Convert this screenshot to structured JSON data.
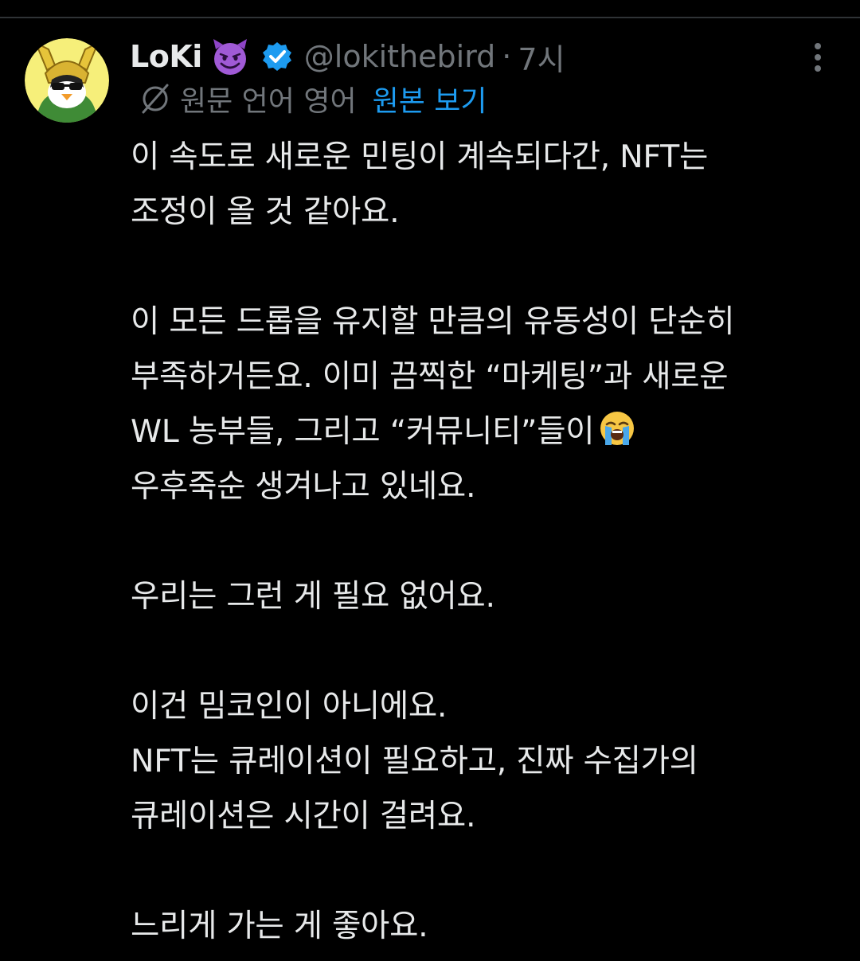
{
  "colors": {
    "background": "#000000",
    "primary_text": "#e7e9ea",
    "secondary_text": "#71767b",
    "link": "#1d9bf0",
    "verified": "#1d9bf0",
    "divider": "#2f3336"
  },
  "tweet": {
    "author": {
      "display_name": "LoKi",
      "badge_emoji": "smiling-face-with-horns",
      "verified": true,
      "handle": "@lokithebird",
      "separator": "·",
      "time": "7시"
    },
    "translation": {
      "icon": "translate-icon",
      "note": "원문 언어 영어",
      "show_original": "원본 보기"
    },
    "body": {
      "p1": {
        "line1": "이 속도로 새로운 민팅이 계속되다간, NFT는",
        "line2": "조정이 올 것 같아요."
      },
      "p2": {
        "line1": "이 모든 드롭을 유지할 만큼의 유동성이 단순히",
        "line2": "부족하거든요. 이미 끔찍한 “마케팅”과 새로운",
        "line3": "WL 농부들, 그리고 “커뮤니티”들이",
        "line3_emoji": "loudly-crying-face",
        "line4": "우후죽순 생겨나고 있네요."
      },
      "p3": {
        "line1": "우리는 그런 게 필요 없어요."
      },
      "p4": {
        "line1": "이건 밈코인이 아니에요.",
        "line2": "NFT는 큐레이션이 필요하고, 진짜 수집가의",
        "line3": "큐레이션은 시간이 걸려요."
      },
      "p5": {
        "line1": "느리게 가는 게 좋아요."
      }
    }
  }
}
